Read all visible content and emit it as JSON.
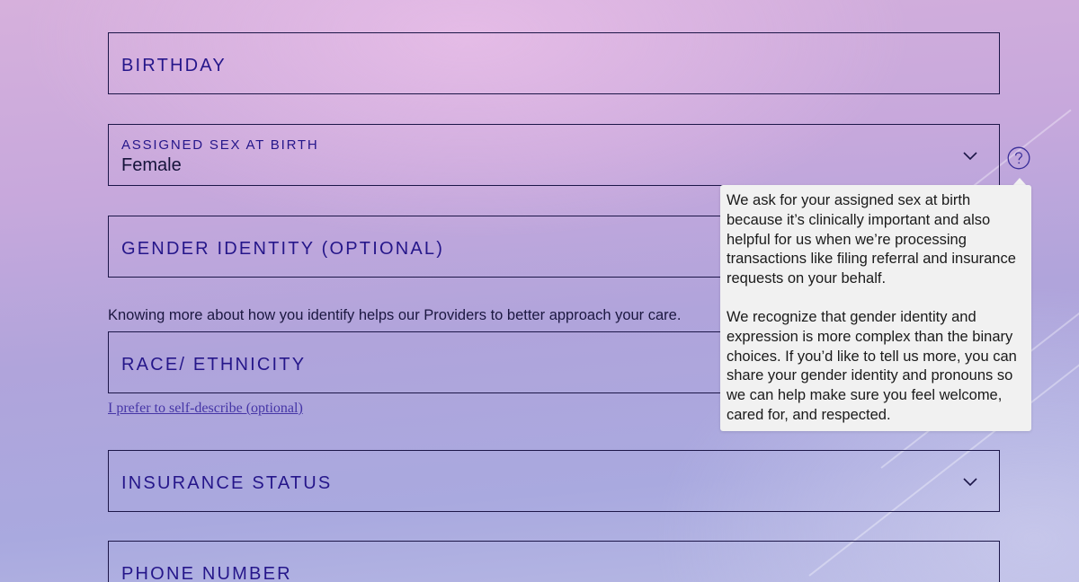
{
  "form": {
    "birthday": {
      "label": "BIRTHDAY"
    },
    "assigned_sex": {
      "label": "ASSIGNED SEX AT BIRTH",
      "value": "Female"
    },
    "gender_identity": {
      "label": "GENDER IDENTITY (OPTIONAL)",
      "helper": "Knowing more about how you identify helps our Providers to better approach your care."
    },
    "race_ethnicity": {
      "label": "RACE/ ETHNICITY",
      "self_describe_link": "I prefer to self-describe (optional)"
    },
    "insurance_status": {
      "label": "INSURANCE STATUS"
    },
    "phone_number": {
      "label": "PHONE NUMBER"
    }
  },
  "tooltip": {
    "paragraph1": "We ask for your assigned sex at birth because it’s clinically important and also helpful for us when we’re processing transactions like filing referral and insurance requests on your behalf.",
    "paragraph2": "We recognize that gender identity and expression is more complex than the binary choices. If you’d like to tell us more, you can share your gender identity and pronouns so we can help make sure you feel welcome, cared for, and respected."
  },
  "colors": {
    "label": "#25168a",
    "border": "#1c1648",
    "link": "#4535a6",
    "tooltip_bg": "#f1f1f1"
  },
  "icons": {
    "dropdown": "chevron-down-icon",
    "help": "question-circle-icon"
  }
}
